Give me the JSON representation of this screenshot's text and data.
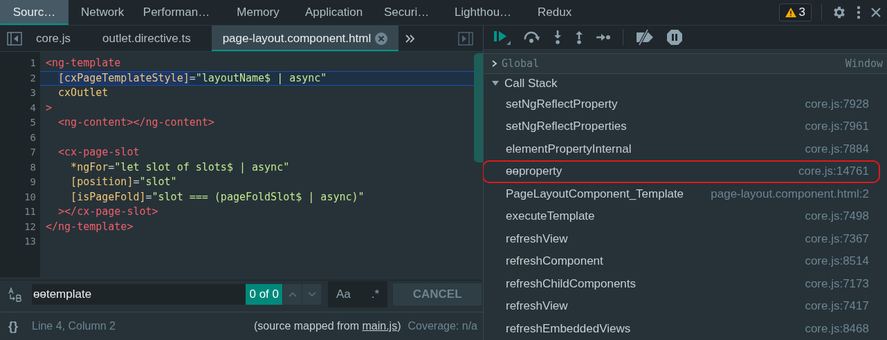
{
  "panel_tabs": [
    {
      "label": "Sourc…",
      "selected": true
    },
    {
      "label": "Network",
      "selected": false
    },
    {
      "label": "Performan…",
      "selected": false
    },
    {
      "label": "Memory",
      "selected": false
    },
    {
      "label": "Application",
      "selected": false
    },
    {
      "label": "Securi…",
      "selected": false
    },
    {
      "label": "Lighthou…",
      "selected": false
    },
    {
      "label": "Redux",
      "selected": false
    }
  ],
  "warnings": {
    "count": "3"
  },
  "file_tabs": [
    {
      "label": "core.js",
      "selected": false
    },
    {
      "label": "outlet.directive.ts",
      "selected": false
    },
    {
      "label": "page-layout.component.html",
      "selected": true
    }
  ],
  "editor": {
    "lines": [
      {
        "number": "1",
        "tokens": [
          {
            "kind": "tag",
            "text": "<ng-template"
          }
        ]
      },
      {
        "number": "2",
        "tokens": [
          {
            "kind": "attr-selected",
            "text": "  [cxPageTemplateStyle]"
          },
          {
            "kind": "punct",
            "text": "="
          },
          {
            "kind": "string",
            "text": "\"layoutName$ | async\""
          }
        ],
        "current": true
      },
      {
        "number": "3",
        "tokens": [
          {
            "kind": "attr",
            "text": "  cxOutlet"
          }
        ]
      },
      {
        "number": "4",
        "tokens": [
          {
            "kind": "tag",
            "text": ">"
          }
        ]
      },
      {
        "number": "5",
        "tokens": [
          {
            "kind": "tag",
            "text": "  <ng-content></ng-content>"
          }
        ]
      },
      {
        "number": "6"
      },
      {
        "number": "7",
        "tokens": [
          {
            "kind": "tag",
            "text": "  <cx-page-slot"
          }
        ]
      },
      {
        "number": "8",
        "tokens": [
          {
            "kind": "attr",
            "text": "    *ngFor"
          },
          {
            "kind": "punct",
            "text": "="
          },
          {
            "kind": "string",
            "text": "\"let slot of slots$ | async\""
          }
        ]
      },
      {
        "number": "9",
        "tokens": [
          {
            "kind": "attr",
            "text": "    [position]"
          },
          {
            "kind": "punct",
            "text": "="
          },
          {
            "kind": "string",
            "text": "\"slot\""
          }
        ]
      },
      {
        "number": "10",
        "tokens": [
          {
            "kind": "attr",
            "text": "    [isPageFold]"
          },
          {
            "kind": "punct",
            "text": "="
          },
          {
            "kind": "string",
            "text": "\"slot === (pageFoldSlot$ | async)\""
          }
        ]
      },
      {
        "number": "11",
        "tokens": [
          {
            "kind": "tag",
            "text": "  ></cx-page-slot>"
          }
        ]
      },
      {
        "number": "12",
        "tokens": [
          {
            "kind": "tag",
            "text": "</ng-template>"
          }
        ]
      },
      {
        "number": "13"
      }
    ]
  },
  "search": {
    "value": "ɵɵtemplate",
    "count": "0 of 0",
    "case_button": "Aa",
    "regex_button": ".*",
    "cancel": "CANCEL"
  },
  "status_bar": {
    "braces": "{}",
    "position": "Line 4, Column 2",
    "mapped_prefix": "(source mapped from ",
    "mapped_link": "main.js",
    "mapped_suffix": ")",
    "coverage": "Coverage: n/a"
  },
  "scope": {
    "label": "Global",
    "value": "Window",
    "expanded": false
  },
  "call_stack": {
    "title": "Call Stack",
    "expanded": true,
    "frames": [
      {
        "name": "setNgReflectProperty",
        "location": "core.js:7928",
        "circled": false
      },
      {
        "name": "setNgReflectProperties",
        "location": "core.js:7961",
        "circled": false
      },
      {
        "name": "elementPropertyInternal",
        "location": "core.js:7884",
        "circled": false
      },
      {
        "name": "ɵɵproperty",
        "location": "core.js:14761",
        "circled": true
      },
      {
        "name": "PageLayoutComponent_Template",
        "location": "page-layout.component.html:2",
        "circled": false
      },
      {
        "name": "executeTemplate",
        "location": "core.js:7498",
        "circled": false
      },
      {
        "name": "refreshView",
        "location": "core.js:7367",
        "circled": false
      },
      {
        "name": "refreshComponent",
        "location": "core.js:8514",
        "circled": false
      },
      {
        "name": "refreshChildComponents",
        "location": "core.js:7173",
        "circled": false
      },
      {
        "name": "refreshView",
        "location": "core.js:7417",
        "circled": false
      },
      {
        "name": "refreshEmbeddedViews",
        "location": "core.js:8468",
        "circled": false
      }
    ]
  }
}
